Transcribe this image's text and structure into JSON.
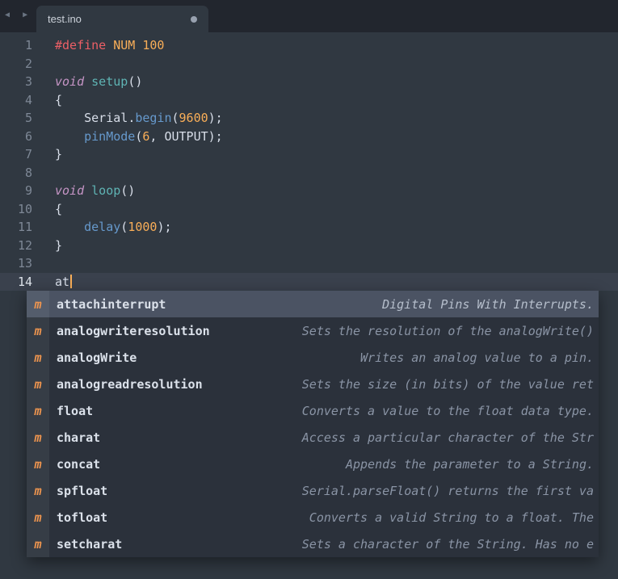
{
  "tab_bar": {
    "tab_title": "test.ino",
    "scroll_left_icon": "◀",
    "scroll_right_icon": "▶"
  },
  "editor": {
    "current_line": 14,
    "lines": [
      {
        "num": "1",
        "tokens": [
          [
            "#define",
            "red"
          ],
          [
            " ",
            "fg"
          ],
          [
            "NUM",
            "orange"
          ],
          [
            " ",
            "fg"
          ],
          [
            "100",
            "orange"
          ]
        ]
      },
      {
        "num": "2",
        "tokens": []
      },
      {
        "num": "3",
        "tokens": [
          [
            "void",
            "purple"
          ],
          [
            " ",
            "fg"
          ],
          [
            "setup",
            "teal"
          ],
          [
            "()",
            "fg"
          ]
        ]
      },
      {
        "num": "4",
        "tokens": [
          [
            "{",
            "fg"
          ]
        ]
      },
      {
        "num": "5",
        "tokens": [
          [
            "    ",
            "fg"
          ],
          [
            "Serial",
            "fg"
          ],
          [
            ".",
            "fg"
          ],
          [
            "begin",
            "blue"
          ],
          [
            "(",
            "fg"
          ],
          [
            "9600",
            "orange"
          ],
          [
            ");",
            "fg"
          ]
        ]
      },
      {
        "num": "6",
        "tokens": [
          [
            "    ",
            "fg"
          ],
          [
            "pinMode",
            "blue"
          ],
          [
            "(",
            "fg"
          ],
          [
            "6",
            "orange"
          ],
          [
            ", ",
            "fg"
          ],
          [
            "OUTPUT",
            "fg"
          ],
          [
            ");",
            "fg"
          ]
        ]
      },
      {
        "num": "7",
        "tokens": [
          [
            "}",
            "fg"
          ]
        ]
      },
      {
        "num": "8",
        "tokens": []
      },
      {
        "num": "9",
        "tokens": [
          [
            "void",
            "purple"
          ],
          [
            " ",
            "fg"
          ],
          [
            "loop",
            "teal"
          ],
          [
            "()",
            "fg"
          ]
        ]
      },
      {
        "num": "10",
        "tokens": [
          [
            "{",
            "fg"
          ]
        ]
      },
      {
        "num": "11",
        "tokens": [
          [
            "    ",
            "fg"
          ],
          [
            "delay",
            "blue"
          ],
          [
            "(",
            "fg"
          ],
          [
            "1000",
            "orange"
          ],
          [
            ");",
            "fg"
          ]
        ]
      },
      {
        "num": "12",
        "tokens": [
          [
            "}",
            "fg"
          ]
        ]
      },
      {
        "num": "13",
        "tokens": []
      },
      {
        "num": "14",
        "tokens": [
          [
            "at",
            "fg"
          ]
        ],
        "caret": true
      }
    ]
  },
  "autocomplete": {
    "kind_letter": "m",
    "items": [
      {
        "label": "attachinterrupt",
        "annotation": "Digital Pins With Interrupts.",
        "selected": true
      },
      {
        "label": "analogwriteresolution",
        "annotation": "Sets the resolution of the analogWrite()"
      },
      {
        "label": "analogWrite",
        "annotation": "Writes an analog value to a pin."
      },
      {
        "label": "analogreadresolution",
        "annotation": "Sets the size (in bits) of the value ret"
      },
      {
        "label": "float",
        "annotation": "Converts a value to the float data type."
      },
      {
        "label": "charat",
        "annotation": "Access a particular character of the Str"
      },
      {
        "label": "concat",
        "annotation": "Appends the parameter to a String."
      },
      {
        "label": "spfloat",
        "annotation": "Serial.parseFloat() returns the first va"
      },
      {
        "label": "tofloat",
        "annotation": "Converts a valid String to a float. The"
      },
      {
        "label": "setcharat",
        "annotation": "Sets a character of the String. Has no e"
      }
    ]
  },
  "colors": {
    "editor_bg": "#303841",
    "tabbar_bg": "#22262e",
    "tab_bg": "#303841",
    "tab_title_fg": "#ccd2da",
    "modified_dot": "#98a1af",
    "current_line_bg": "#3a414d",
    "gutter_fg": "#7e8896",
    "gutter_active_fg": "#dde3ea",
    "caret": "#f9ae58",
    "popup_bg": "#2b313b",
    "popup_selected_bg": "#4b5363",
    "kind_fg": "#f0964f",
    "label_fg": "#dbe1ea",
    "annotation_fg": "#8a94a5",
    "annotation_selected_fg": "#b6bfcc",
    "syntax": {
      "red": "#ec5f66",
      "orange": "#f9ae58",
      "purple": "#c695c6",
      "teal": "#5fb4b4",
      "blue": "#6699cc",
      "fg": "#d8dee9"
    }
  }
}
